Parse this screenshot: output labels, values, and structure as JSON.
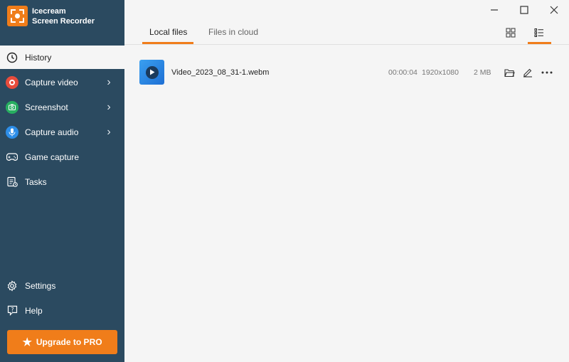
{
  "app": {
    "name_line1": "Icecream",
    "name_line2": "Screen Recorder"
  },
  "sidebar": {
    "items": [
      {
        "label": "History",
        "icon": "clock-icon",
        "active": true
      },
      {
        "label": "Capture video",
        "icon": "record-icon",
        "color": "#e74c3c"
      },
      {
        "label": "Screenshot",
        "icon": "camera-icon",
        "color": "#27ae60"
      },
      {
        "label": "Capture audio",
        "icon": "microphone-icon",
        "color": "#2d8ee8"
      },
      {
        "label": "Game capture",
        "icon": "gamepad-icon"
      },
      {
        "label": "Tasks",
        "icon": "tasks-icon"
      }
    ],
    "bottom_items": [
      {
        "label": "Settings",
        "icon": "gear-icon"
      },
      {
        "label": "Help",
        "icon": "help-icon"
      }
    ],
    "upgrade_label": "Upgrade to PRO"
  },
  "tabs": [
    {
      "label": "Local files",
      "active": true
    },
    {
      "label": "Files in cloud",
      "active": false
    }
  ],
  "files": [
    {
      "name": "Video_2023_08_31-1.webm",
      "duration": "00:00:04",
      "resolution": "1920x1080",
      "size": "2 MB"
    }
  ],
  "colors": {
    "sidebar": "#2b4a60",
    "accent": "#f07d1a",
    "background": "#f5f5f5"
  }
}
